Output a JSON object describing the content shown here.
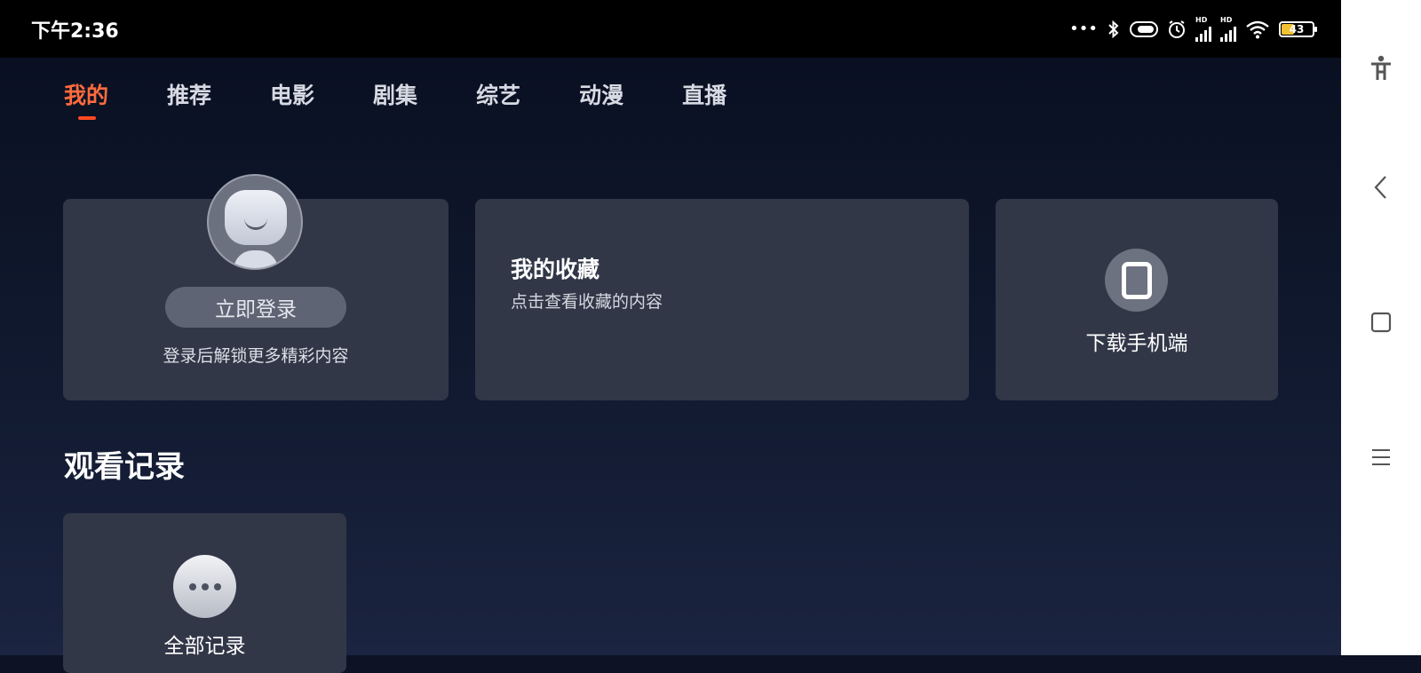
{
  "status_bar": {
    "time": "下午2:36",
    "dots": "•••",
    "battery_level": "43",
    "signal_labels": [
      "HD",
      "HD"
    ]
  },
  "tabs": [
    {
      "label": "我的",
      "active": true
    },
    {
      "label": "推荐",
      "active": false
    },
    {
      "label": "电影",
      "active": false
    },
    {
      "label": "剧集",
      "active": false
    },
    {
      "label": "综艺",
      "active": false
    },
    {
      "label": "动漫",
      "active": false
    },
    {
      "label": "直播",
      "active": false
    }
  ],
  "login_card": {
    "button_label": "立即登录",
    "hint": "登录后解锁更多精彩内容"
  },
  "favorites_card": {
    "title": "我的收藏",
    "subtitle": "点击查看收藏的内容"
  },
  "download_card": {
    "label": "下载手机端"
  },
  "history": {
    "section_title": "观看记录",
    "all_label": "全部记录"
  },
  "colors": {
    "accent": "#ff6b3d",
    "card_bg": "#323748",
    "page_bg": "#0d1324"
  }
}
